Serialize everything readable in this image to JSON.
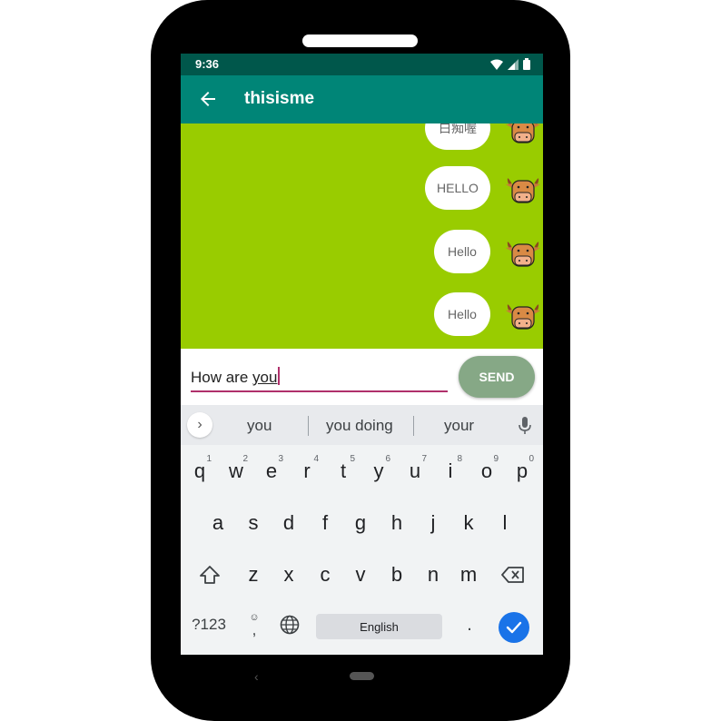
{
  "status_bar": {
    "time": "9:36",
    "icons": [
      "wifi-icon",
      "signal-icon",
      "battery-icon"
    ]
  },
  "app_bar": {
    "title": "thisisme",
    "back_icon": "arrow-left-icon"
  },
  "chat": {
    "background": "#99cc00",
    "messages": [
      {
        "text": "白痴喔"
      },
      {
        "text": "HELLO"
      },
      {
        "text": "Hello"
      },
      {
        "text": "Hello"
      }
    ]
  },
  "composer": {
    "input_value_plain": "How are ",
    "input_value_underlined": "you",
    "send_label": "SEND"
  },
  "keyboard": {
    "suggestions": [
      "you",
      "you doing",
      "your"
    ],
    "row1": [
      {
        "k": "q",
        "n": "1"
      },
      {
        "k": "w",
        "n": "2"
      },
      {
        "k": "e",
        "n": "3"
      },
      {
        "k": "r",
        "n": "4"
      },
      {
        "k": "t",
        "n": "5"
      },
      {
        "k": "y",
        "n": "6"
      },
      {
        "k": "u",
        "n": "7"
      },
      {
        "k": "i",
        "n": "8"
      },
      {
        "k": "o",
        "n": "9"
      },
      {
        "k": "p",
        "n": "0"
      }
    ],
    "row2": [
      "a",
      "s",
      "d",
      "f",
      "g",
      "h",
      "j",
      "k",
      "l"
    ],
    "row3": [
      "z",
      "x",
      "c",
      "v",
      "b",
      "n",
      "m"
    ],
    "symbols_label": "?123",
    "comma_label": ",",
    "space_label": "English",
    "period_label": "."
  }
}
